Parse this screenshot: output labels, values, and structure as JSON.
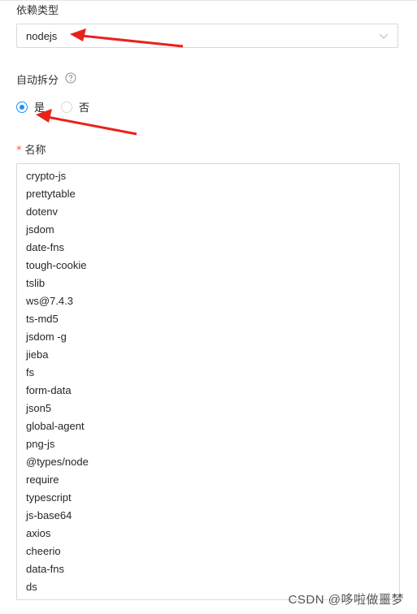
{
  "dependency_type": {
    "label": "依赖类型",
    "value": "nodejs"
  },
  "auto_split": {
    "label": "自动拆分",
    "options": [
      {
        "label": "是",
        "selected": true
      },
      {
        "label": "否",
        "selected": false
      }
    ]
  },
  "name_field": {
    "required_mark": "*",
    "label": "名称",
    "lines": [
      "crypto-js",
      "prettytable",
      "dotenv",
      "jsdom",
      "date-fns",
      "tough-cookie",
      "tslib",
      "ws@7.4.3",
      "ts-md5",
      "jsdom -g",
      "jieba",
      "fs",
      "form-data",
      "json5",
      "global-agent",
      "png-js",
      "@types/node",
      "require",
      "typescript",
      "js-base64",
      "axios",
      "cheerio",
      "data-fns",
      "ds"
    ]
  },
  "watermark": "CSDN @哆啦做噩梦",
  "colors": {
    "accent": "#1890ff",
    "required": "#ff4d4f",
    "annotation_arrow": "#e8231c"
  },
  "icons": {
    "select_caret": "chevron-down-icon",
    "help": "question-circle-icon"
  }
}
